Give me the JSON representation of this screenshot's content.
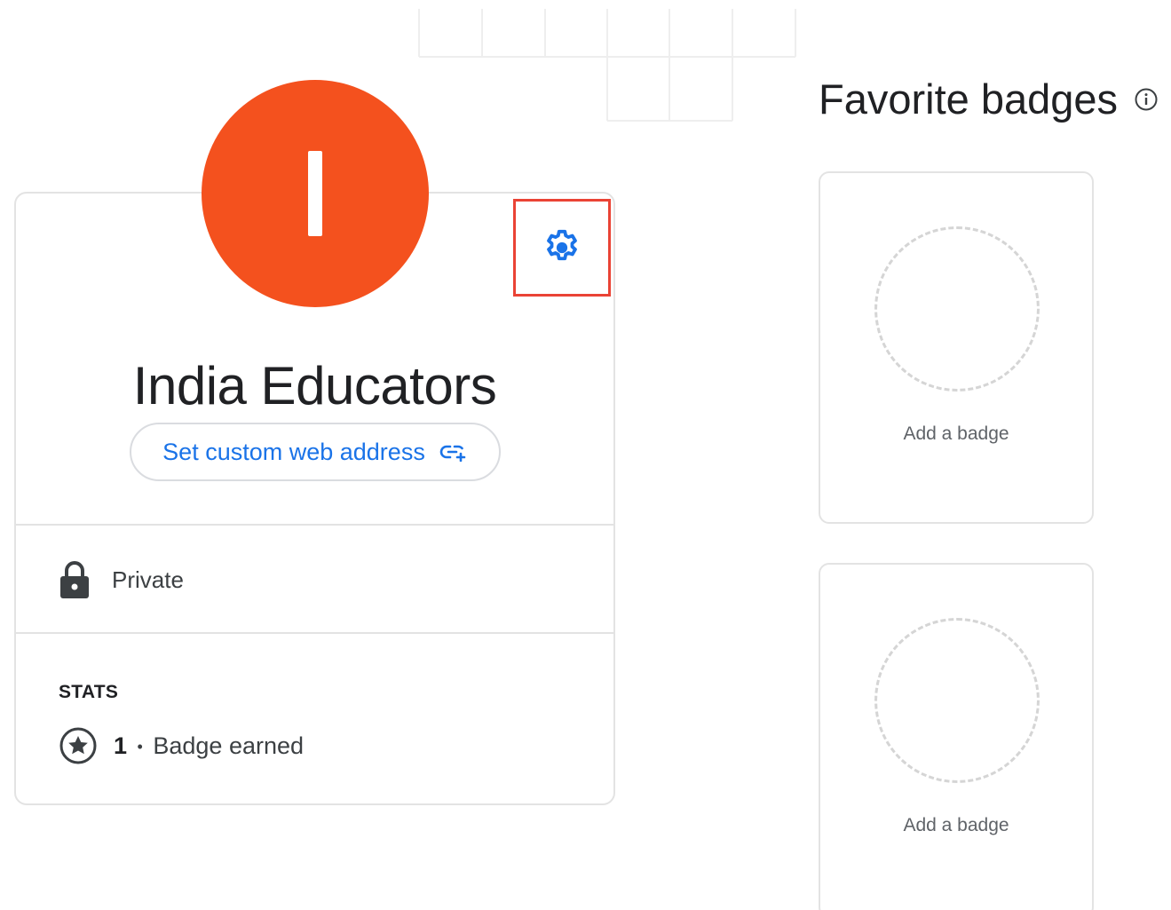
{
  "profile": {
    "avatar_initial": "I",
    "avatar_color": "#f4511e",
    "name": "India Educators",
    "custom_address_label": "Set custom web address",
    "privacy_label": "Private",
    "stats_heading": "STATS",
    "badges_count": "1",
    "badges_separator": "•",
    "badges_label": "Badge earned",
    "settings_icon": "gear-icon",
    "link_icon": "link-add-icon",
    "privacy_icon": "lock-icon",
    "badge_icon": "star-circle-icon"
  },
  "favorites": {
    "title": "Favorite badges",
    "info_icon": "info-icon",
    "slots": [
      {
        "label": "Add a badge"
      },
      {
        "label": "Add a badge"
      }
    ]
  },
  "colors": {
    "accent": "#1a73e8",
    "avatar": "#f4511e",
    "highlight": "#ea4335"
  }
}
